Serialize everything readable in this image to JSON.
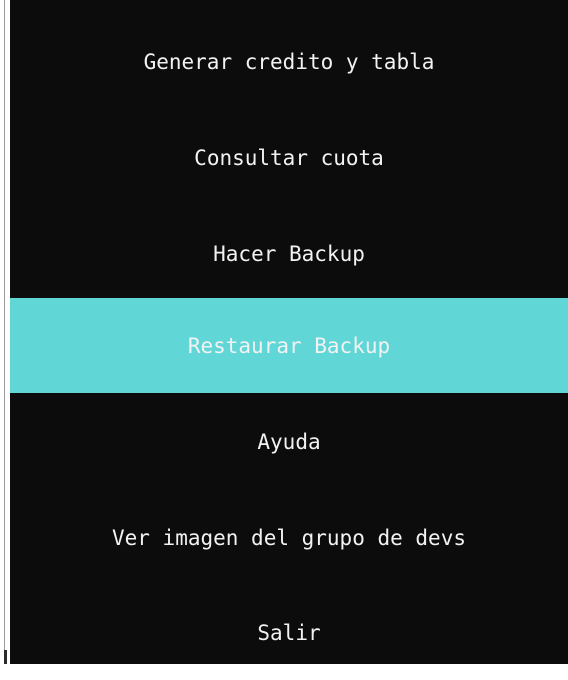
{
  "menu": {
    "items": [
      {
        "label": "Generar credito y tabla"
      },
      {
        "label": "Consultar cuota"
      },
      {
        "label": "Hacer Backup"
      },
      {
        "label": "Restaurar Backup"
      },
      {
        "label": "Ayuda"
      },
      {
        "label": "Ver imagen del grupo de devs"
      },
      {
        "label": "Salir"
      }
    ],
    "selected_label": "Restaurar Backup"
  },
  "colors": {
    "background": "#0c0c0c",
    "text": "#f2f2f2",
    "highlight": "#61d6d6"
  }
}
